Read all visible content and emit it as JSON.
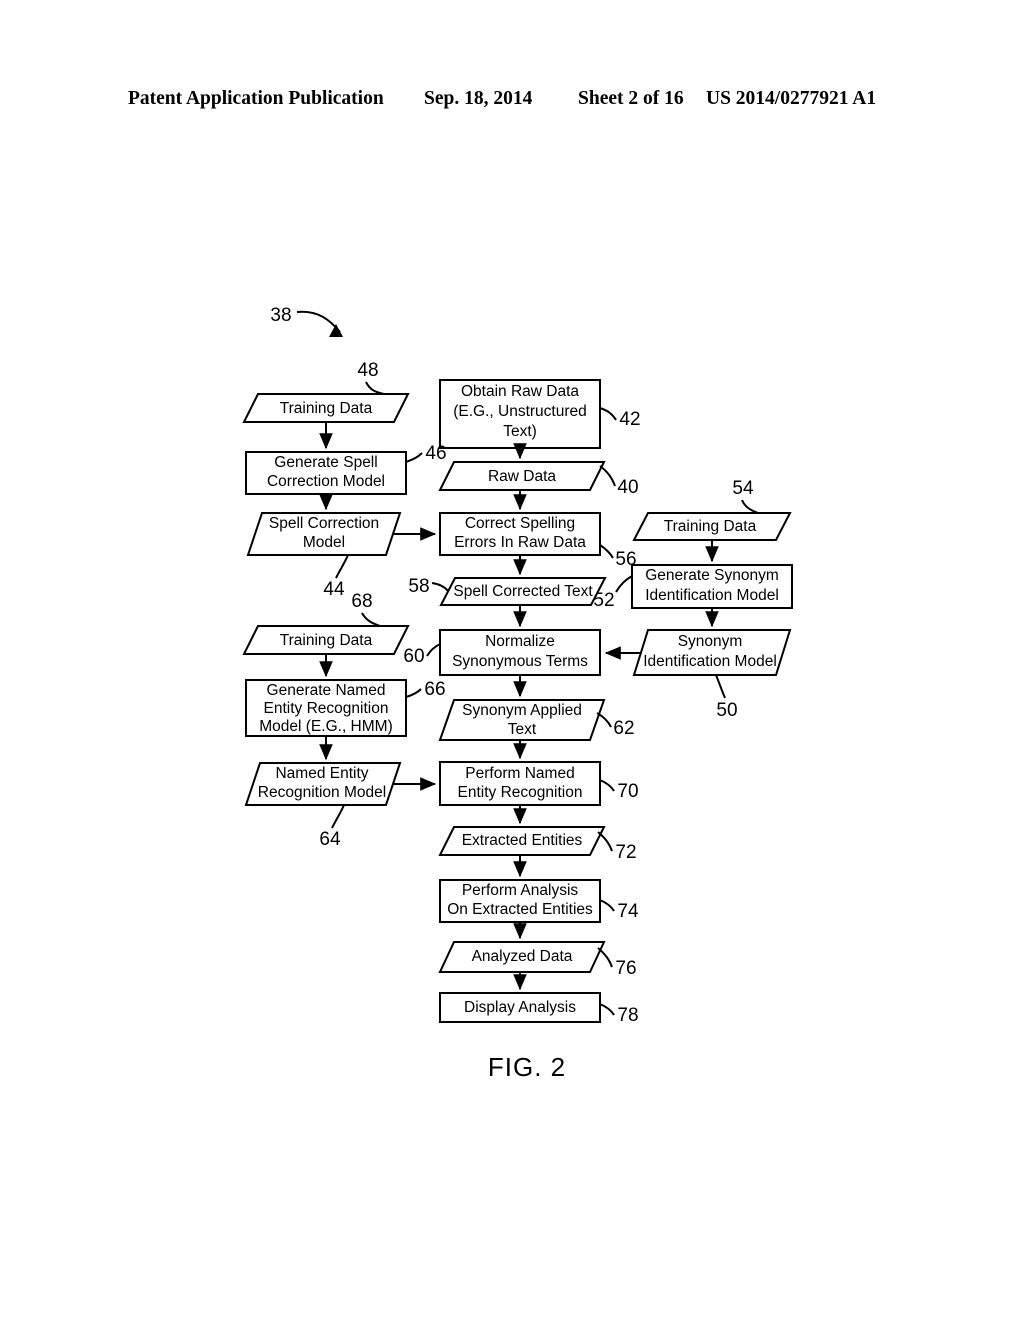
{
  "header": {
    "title": "Patent Application Publication",
    "date": "Sep. 18, 2014",
    "sheet": "Sheet 2 of 16",
    "publication_number": "US 2014/0277921 A1"
  },
  "figure": {
    "caption": "FIG. 2",
    "diagram_ref": "38"
  },
  "nodes": [
    {
      "id": "n48",
      "ref": "48",
      "shape": "parallelogram",
      "lines": [
        "Training Data"
      ]
    },
    {
      "id": "n42",
      "ref": "42",
      "shape": "rect",
      "lines": [
        "Obtain Raw Data",
        "(E.G., Unstructured",
        "Text)"
      ]
    },
    {
      "id": "n46",
      "ref": "46",
      "shape": "rect",
      "lines": [
        "Generate Spell",
        "Correction Model"
      ]
    },
    {
      "id": "n40",
      "ref": "40",
      "shape": "parallelogram",
      "lines": [
        "Raw Data"
      ]
    },
    {
      "id": "n44",
      "ref": "44",
      "shape": "parallelogram",
      "lines": [
        "Spell Correction",
        "Model"
      ]
    },
    {
      "id": "n56",
      "ref": "56",
      "shape": "rect",
      "lines": [
        "Correct Spelling",
        "Errors In Raw Data"
      ]
    },
    {
      "id": "n54",
      "ref": "54",
      "shape": "parallelogram",
      "lines": [
        "Training Data"
      ]
    },
    {
      "id": "n52",
      "ref": "52",
      "shape": "rect",
      "lines": [
        "Generate Synonym",
        "Identification Model"
      ]
    },
    {
      "id": "n58",
      "ref": "58",
      "shape": "parallelogram",
      "lines": [
        "Spell Corrected Text"
      ]
    },
    {
      "id": "n68",
      "ref": "68",
      "shape": "parallelogram",
      "lines": [
        "Training Data"
      ]
    },
    {
      "id": "n60",
      "ref": "60",
      "shape": "rect",
      "lines": [
        "Normalize",
        "Synonymous Terms"
      ]
    },
    {
      "id": "n50",
      "ref": "50",
      "shape": "parallelogram",
      "lines": [
        "Synonym",
        "Identification Model"
      ]
    },
    {
      "id": "n66",
      "ref": "66",
      "shape": "rect",
      "lines": [
        "Generate Named",
        "Entity Recognition",
        "Model (E.G., HMM)"
      ]
    },
    {
      "id": "n62",
      "ref": "62",
      "shape": "parallelogram",
      "lines": [
        "Synonym Applied",
        "Text"
      ]
    },
    {
      "id": "n64",
      "ref": "64",
      "shape": "parallelogram",
      "lines": [
        "Named Entity",
        "Recognition Model"
      ]
    },
    {
      "id": "n70",
      "ref": "70",
      "shape": "rect",
      "lines": [
        "Perform Named",
        "Entity Recognition"
      ]
    },
    {
      "id": "n72",
      "ref": "72",
      "shape": "parallelogram",
      "lines": [
        "Extracted Entities"
      ]
    },
    {
      "id": "n74",
      "ref": "74",
      "shape": "rect",
      "lines": [
        "Perform Analysis",
        "On Extracted Entities"
      ]
    },
    {
      "id": "n76",
      "ref": "76",
      "shape": "parallelogram",
      "lines": [
        "Analyzed Data"
      ]
    },
    {
      "id": "n78",
      "ref": "78",
      "shape": "rect",
      "lines": [
        "Display Analysis"
      ]
    }
  ],
  "colors": {
    "ink": "#000000",
    "paper": "#ffffff"
  }
}
